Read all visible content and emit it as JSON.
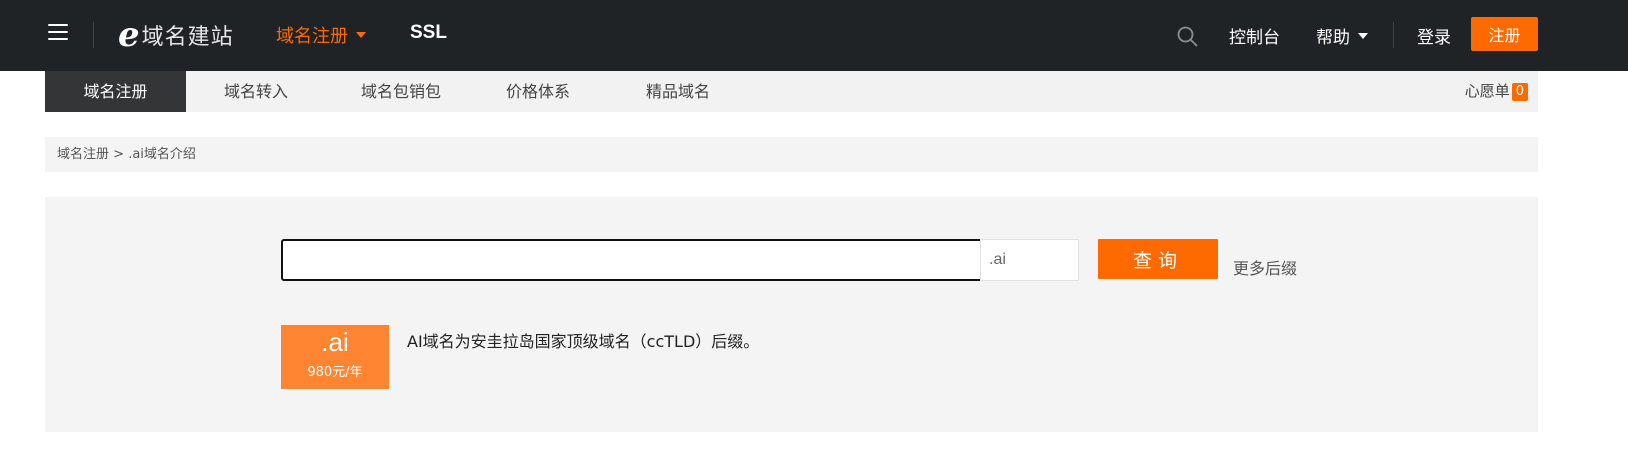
{
  "topbar": {
    "logo_mark": "e",
    "logo_text": "域名建站",
    "nav_domain_label": "域名注册",
    "nav_ssl_label": "SSL",
    "console_label": "控制台",
    "help_label": "帮助",
    "login_label": "登录",
    "register_label": "注册",
    "accent_color": "#ff6a00",
    "bg_color": "#1f2326"
  },
  "subnav": {
    "tabs": [
      {
        "label": "域名注册"
      },
      {
        "label": "域名转入"
      },
      {
        "label": "域名包销包"
      },
      {
        "label": "价格体系"
      },
      {
        "label": "精品域名"
      }
    ],
    "active_index": 0,
    "wishlist_label": "心愿单",
    "wishlist_count": "0"
  },
  "breadcrumb": {
    "parent": "域名注册",
    "separator": " > ",
    "current": ".ai域名介绍"
  },
  "search": {
    "value": "",
    "suffix": ".ai",
    "query_label": "查询",
    "more_suffix_label": "更多后缀"
  },
  "tld": {
    "name": ".ai",
    "price": "980元/年",
    "description": "AI域名为安圭拉岛国家顶级域名（ccTLD）后缀。"
  }
}
